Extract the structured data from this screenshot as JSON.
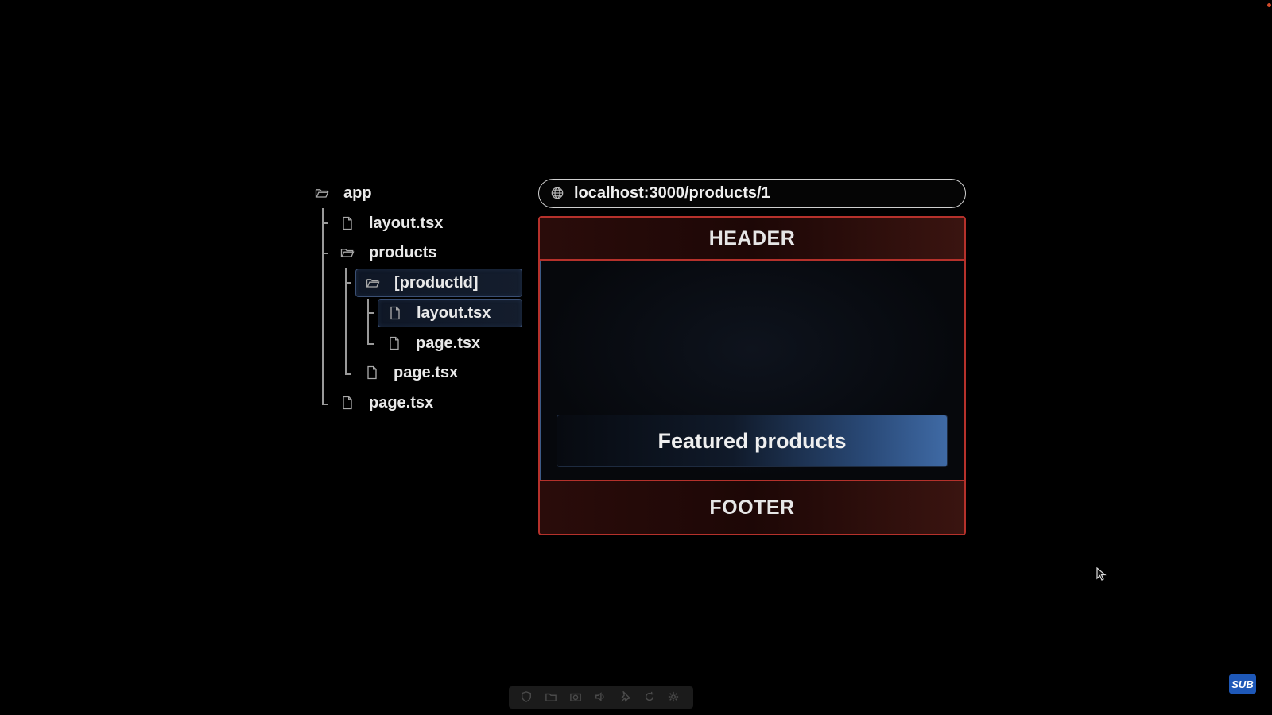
{
  "tree": {
    "items": [
      {
        "label": "app",
        "icon": "folder-open-icon"
      },
      {
        "label": "layout.tsx",
        "icon": "file-icon"
      },
      {
        "label": "products",
        "icon": "folder-open-icon"
      },
      {
        "label": "[productId]",
        "icon": "folder-open-icon"
      },
      {
        "label": "layout.tsx",
        "icon": "file-icon"
      },
      {
        "label": "page.tsx",
        "icon": "file-icon"
      },
      {
        "label": "page.tsx",
        "icon": "file-icon"
      },
      {
        "label": "page.tsx",
        "icon": "file-icon"
      }
    ]
  },
  "browser": {
    "url": "localhost:3000/products/1",
    "header": "HEADER",
    "footer": "FOOTER",
    "featured": "Featured products"
  },
  "badge": {
    "label": "SUB"
  },
  "colors": {
    "layout_border": "#b5312b",
    "content_border": "#3c5a86",
    "selection_border": "#3a4f73",
    "badge": "#1e58b8"
  }
}
